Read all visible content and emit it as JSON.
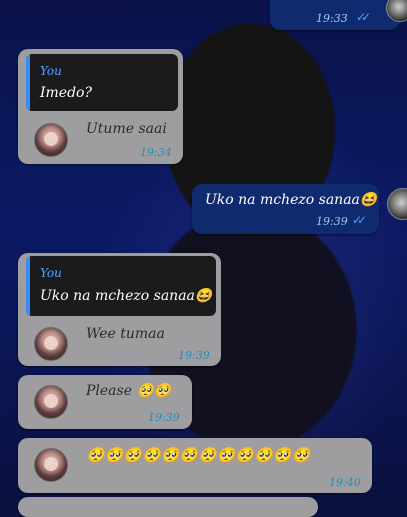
{
  "messages": [
    {
      "id": "m0",
      "direction": "outgoing",
      "text": "",
      "time": "19:33"
    },
    {
      "id": "m1",
      "direction": "incoming",
      "quote_author": "You",
      "quote_text": "Imedo?",
      "text": "Utume saai",
      "time": "19:34"
    },
    {
      "id": "m2",
      "direction": "outgoing",
      "text": "Uko na mchezo sanaa😆",
      "time": "19:39"
    },
    {
      "id": "m3",
      "direction": "incoming",
      "quote_author": "You",
      "quote_text": "Uko na mchezo sanaa😆",
      "text": "Wee tumaa",
      "time": "19:39"
    },
    {
      "id": "m4",
      "direction": "incoming",
      "text": "Please 🥺🥺",
      "time": "19:39"
    },
    {
      "id": "m5",
      "direction": "incoming",
      "text": "🥺🥺🥺🥺🥺🥺🥺🥺🥺🥺🥺🥺",
      "time": "19:40"
    }
  ],
  "read_receipt_icon": "double-check-icon",
  "colors": {
    "incoming_bubble": "#9e9ea1",
    "outgoing_bubble": "#0f2a6e",
    "quote_bar": "#3a8ef6",
    "time": "#1f8fbf"
  }
}
